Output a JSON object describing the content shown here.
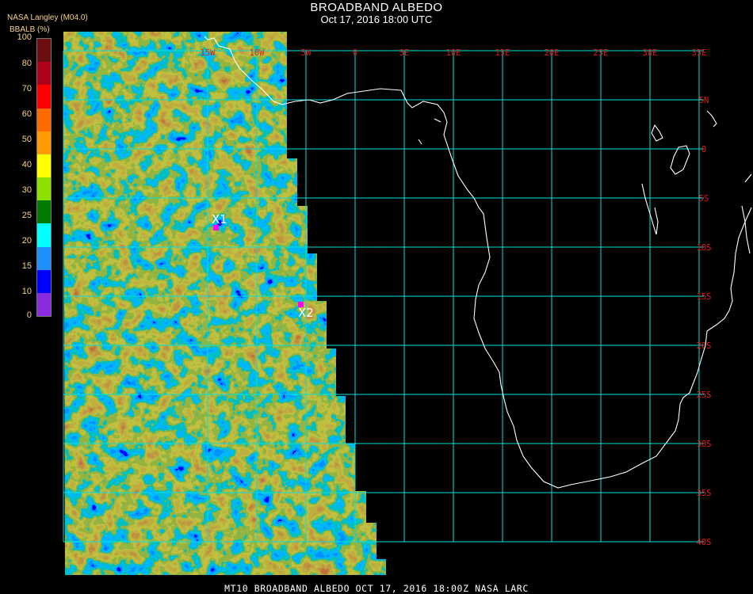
{
  "title": "BROADBAND ALBEDO",
  "subtitle": "Oct 17, 2016 18:00 UTC",
  "producer": "NASA Langley (M04.0)",
  "colorbar": {
    "label": "BBALB (%)",
    "ticks": [
      "100",
      "80",
      "70",
      "60",
      "50",
      "40",
      "30",
      "25",
      "20",
      "15",
      "10",
      "0"
    ],
    "colors": [
      "#6b0f10",
      "#b0001a",
      "#ff0000",
      "#ff6a00",
      "#ff9a00",
      "#ffff00",
      "#8ce000",
      "#007a00",
      "#00ffff",
      "#1e90ff",
      "#0000ff",
      "#8a2be2"
    ]
  },
  "longitude_labels": [
    "15W",
    "10W",
    "5W",
    "0",
    "5E",
    "10E",
    "15E",
    "20E",
    "25E",
    "30E",
    "35E"
  ],
  "latitude_labels": [
    "5N",
    "0",
    "5S",
    "10S",
    "15S",
    "20S",
    "25S",
    "30S",
    "35S",
    "40S"
  ],
  "markers": [
    {
      "label": "X1",
      "color": "#ff00ff"
    },
    {
      "label": "X2",
      "color": "#ff00ff"
    }
  ],
  "grid_color": "#00e0e0",
  "footer": "MT10  BROADBAND ALBEDO   OCT 17, 2016 18:00Z   NASA LARC"
}
